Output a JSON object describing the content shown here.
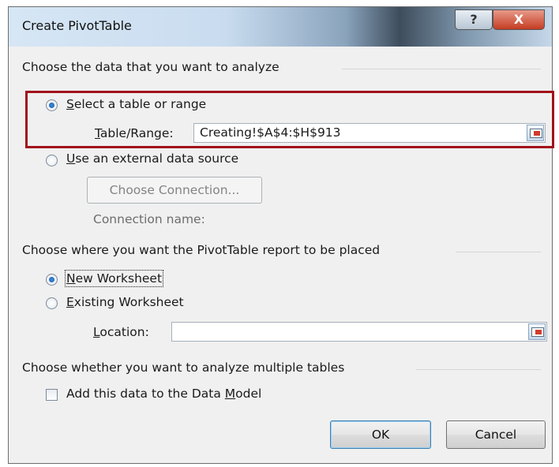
{
  "dialog": {
    "title": "Create PivotTable",
    "help_label": "?",
    "close_label": "X"
  },
  "data_source": {
    "heading": "Choose the data that you want to analyze",
    "select_range": {
      "prefix": "",
      "accel": "S",
      "rest": "elect a table or range",
      "selected": true
    },
    "table_range": {
      "accel": "T",
      "rest": "able/Range:",
      "value": "Creating!$A$4:$H$913"
    },
    "external": {
      "accel": "U",
      "rest": "se an external data source",
      "selected": false
    },
    "choose_connection_label": "Choose Connection...",
    "connection_name_label": "Connection name:"
  },
  "placement": {
    "heading": "Choose where you want the PivotTable report to be placed",
    "new_worksheet": {
      "accel": "N",
      "rest": "ew Worksheet",
      "selected": true
    },
    "existing_worksheet": {
      "accel": "E",
      "rest": "xisting Worksheet",
      "selected": false
    },
    "location": {
      "accel": "L",
      "rest": "ocation:",
      "value": ""
    }
  },
  "multiple_tables": {
    "heading": "Choose whether you want to analyze multiple tables",
    "data_model": {
      "before": "Add this data to the Data ",
      "accel": "M",
      "after": "odel",
      "checked": false
    }
  },
  "buttons": {
    "ok_label": "OK",
    "cancel_label": "Cancel"
  },
  "colors": {
    "highlight_border": "#a10f1a",
    "radio_selected": "#1859a6"
  },
  "icons": {
    "range_selector": "collapse-dialog-icon",
    "radio": "radio-icon",
    "checkbox": "checkbox-icon"
  }
}
